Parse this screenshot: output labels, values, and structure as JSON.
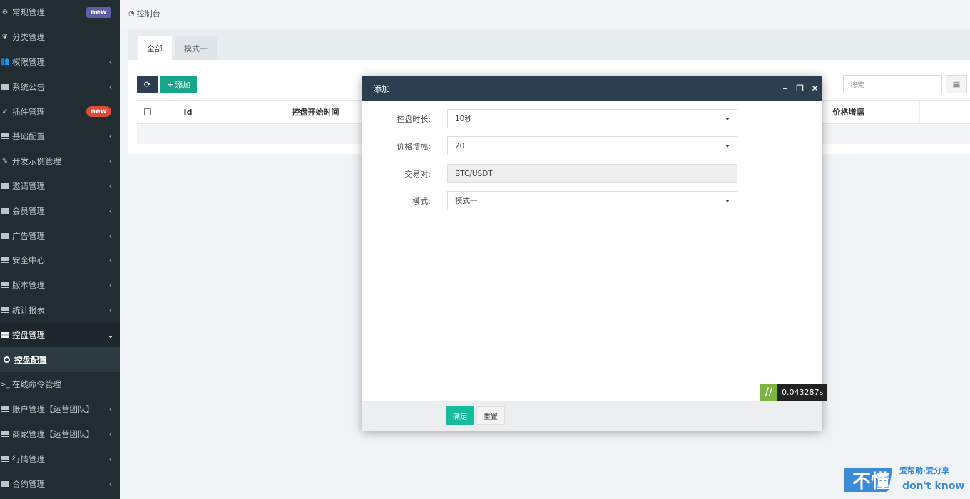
{
  "sidebar": {
    "items": [
      {
        "label": "常规管理",
        "badge": "new"
      },
      {
        "label": "分类管理"
      },
      {
        "label": "权限管理"
      },
      {
        "label": "系统公告"
      },
      {
        "label": "插件管理",
        "badge": "new"
      },
      {
        "label": "基础配置"
      },
      {
        "label": "开发示例管理"
      },
      {
        "label": "邀请管理"
      },
      {
        "label": "会员管理"
      },
      {
        "label": "广告管理"
      },
      {
        "label": "安全中心"
      },
      {
        "label": "版本管理"
      },
      {
        "label": "统计报表"
      },
      {
        "label": "控盘管理"
      },
      {
        "label": "控盘配置"
      },
      {
        "label": "在线命令管理"
      },
      {
        "label": "账户管理【运营团队】"
      },
      {
        "label": "商家管理【运营团队】"
      },
      {
        "label": "行情管理"
      },
      {
        "label": "合约管理"
      }
    ],
    "colors": {
      "bg": "#222d32",
      "active": "#1e282c"
    }
  },
  "breadcrumb": {
    "label": "控制台"
  },
  "tabs": [
    {
      "label": "全部"
    },
    {
      "label": "模式一"
    }
  ],
  "toolbar": {
    "add_label": "添加"
  },
  "search": {
    "placeholder": "搜索"
  },
  "table": {
    "columns": [
      "Id",
      "控盘开始时间",
      "价格增幅"
    ]
  },
  "modal": {
    "title": "添加",
    "fields": [
      {
        "label": "控盘时长:",
        "value": "10秒"
      },
      {
        "label": "价格增幅:",
        "value": "20"
      },
      {
        "label": "交易对:",
        "value": "BTC/USDT"
      },
      {
        "label": "模式:",
        "value": "模式一"
      }
    ],
    "confirm_label": "确定",
    "reset_label": "重置",
    "timer": "0.043287s"
  },
  "watermark": {
    "line1": "爱帮助·爱分享",
    "line2": "don't know"
  }
}
